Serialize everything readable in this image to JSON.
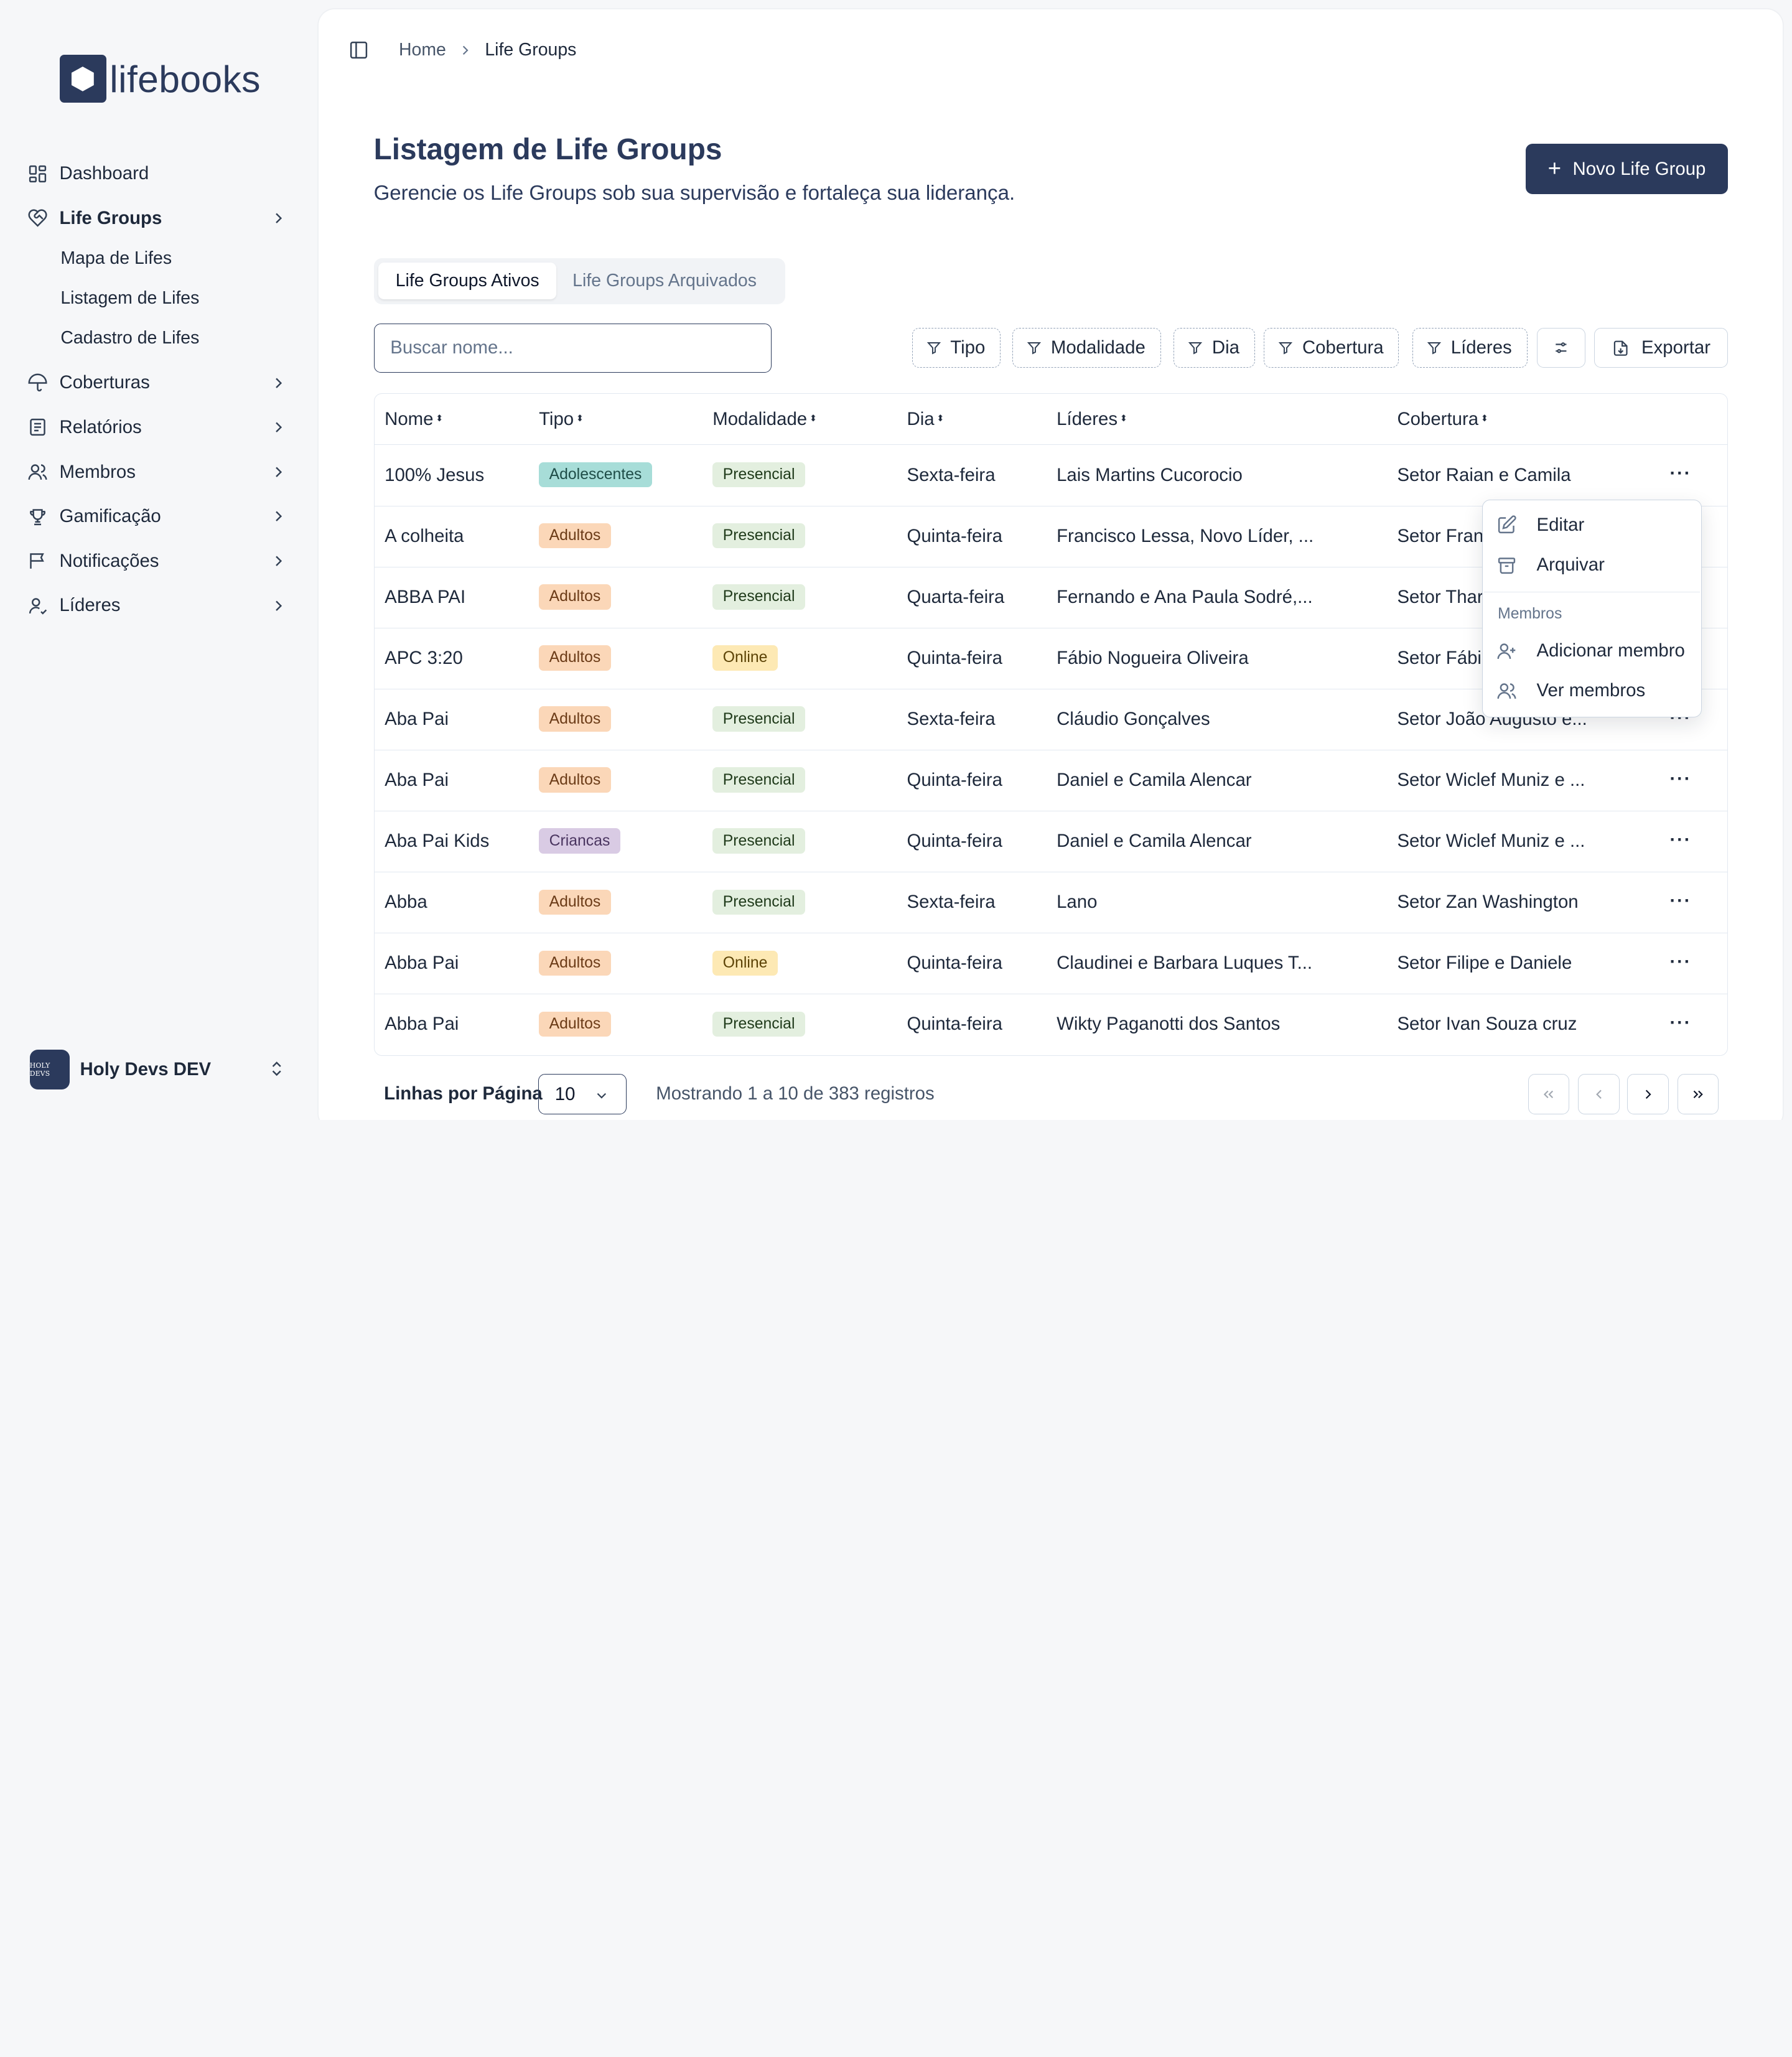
{
  "brand": {
    "name": "lifebooks"
  },
  "sidebar": {
    "items": [
      {
        "label": "Dashboard",
        "icon": "dashboard-icon"
      },
      {
        "label": "Life Groups",
        "icon": "heart-handshake-icon"
      },
      {
        "label": "Coberturas",
        "icon": "umbrella-icon"
      },
      {
        "label": "Relatórios",
        "icon": "report-icon"
      },
      {
        "label": "Membros",
        "icon": "users-icon"
      },
      {
        "label": "Gamificação",
        "icon": "trophy-icon"
      },
      {
        "label": "Notificações",
        "icon": "message-flag-icon"
      },
      {
        "label": "Líderes",
        "icon": "leader-icon"
      }
    ],
    "subitems": [
      {
        "label": "Mapa de Lifes"
      },
      {
        "label": "Listagem de Lifes"
      },
      {
        "label": "Cadastro de Lifes"
      }
    ],
    "user": {
      "name": "Holy Devs DEV",
      "avatar_text": "HOLY DEVS"
    }
  },
  "breadcrumb": {
    "home": "Home",
    "current": "Life Groups"
  },
  "page": {
    "title": "Listagem de Life Groups",
    "subtitle": "Gerencie os Life Groups sob sua supervisão e fortaleça sua liderança.",
    "new_button": "Novo Life Group"
  },
  "tabs": {
    "active": "Life Groups Ativos",
    "archived": "Life Groups Arquivados"
  },
  "search": {
    "placeholder": "Buscar nome...",
    "value": ""
  },
  "filters": {
    "tipo": "Tipo",
    "modalidade": "Modalidade",
    "dia": "Dia",
    "cobertura": "Cobertura",
    "lideres": "Líderes"
  },
  "export_label": "Exportar",
  "table": {
    "headers": {
      "nome": "Nome",
      "tipo": "Tipo",
      "modalidade": "Modalidade",
      "dia": "Dia",
      "lideres": "Líderes",
      "cobertura": "Cobertura"
    },
    "rows": [
      {
        "nome": "100% Jesus",
        "tipo": "Adolescentes",
        "modalidade": "Presencial",
        "dia": "Sexta-feira",
        "lideres": "Lais Martins Cucorocio",
        "cobertura": "Setor Raian e Camila"
      },
      {
        "nome": "A colheita",
        "tipo": "Adultos",
        "modalidade": "Presencial",
        "dia": "Quinta-feira",
        "lideres": "Francisco Lessa, Novo Líder, ...",
        "cobertura": "Setor Fran"
      },
      {
        "nome": "ABBA PAI",
        "tipo": "Adultos",
        "modalidade": "Presencial",
        "dia": "Quarta-feira",
        "lideres": "Fernando e Ana Paula Sodré,...",
        "cobertura": "Setor Thar"
      },
      {
        "nome": "APC 3:20",
        "tipo": "Adultos",
        "modalidade": "Online",
        "dia": "Quinta-feira",
        "lideres": "Fábio Nogueira Oliveira",
        "cobertura": "Setor Fábi"
      },
      {
        "nome": "Aba Pai",
        "tipo": "Adultos",
        "modalidade": "Presencial",
        "dia": "Sexta-feira",
        "lideres": "Cláudio Gonçalves",
        "cobertura": "Setor João Augusto e..."
      },
      {
        "nome": "Aba Pai",
        "tipo": "Adultos",
        "modalidade": "Presencial",
        "dia": "Quinta-feira",
        "lideres": "Daniel e Camila Alencar",
        "cobertura": "Setor Wiclef Muniz e ..."
      },
      {
        "nome": "Aba Pai Kids",
        "tipo": "Criancas",
        "modalidade": "Presencial",
        "dia": "Quinta-feira",
        "lideres": "Daniel e Camila Alencar",
        "cobertura": "Setor Wiclef Muniz e ..."
      },
      {
        "nome": "Abba",
        "tipo": "Adultos",
        "modalidade": "Presencial",
        "dia": "Sexta-feira",
        "lideres": "Lano",
        "cobertura": "Setor Zan Washington"
      },
      {
        "nome": "Abba Pai",
        "tipo": "Adultos",
        "modalidade": "Online",
        "dia": "Quinta-feira",
        "lideres": "Claudinei e Barbara Luques T...",
        "cobertura": "Setor Filipe e Daniele"
      },
      {
        "nome": "Abba Pai",
        "tipo": "Adultos",
        "modalidade": "Presencial",
        "dia": "Quinta-feira",
        "lideres": "Wikty Paganotti dos Santos",
        "cobertura": "Setor Ivan Souza cruz"
      }
    ]
  },
  "badge_colors": {
    "Adolescentes": {
      "bg": "#a7ddd8",
      "fg": "#1f4d48"
    },
    "Adultos": {
      "bg": "#fbd7b8",
      "fg": "#6b3b17"
    },
    "Criancas": {
      "bg": "#d9cbe4",
      "fg": "#4a3560"
    },
    "Presencial": {
      "bg": "#e3efdf",
      "fg": "#1f3a1a"
    },
    "Online": {
      "bg": "#fde9b4",
      "fg": "#5c4306"
    }
  },
  "row_menu": {
    "edit": "Editar",
    "archive": "Arquivar",
    "section": "Membros",
    "add_member": "Adicionar membro",
    "view_members": "Ver membros"
  },
  "pagination": {
    "rows_label": "Linhas por Página",
    "rows_value": "10",
    "showing": "Mostrando 1 a 10 de 383 registros"
  }
}
